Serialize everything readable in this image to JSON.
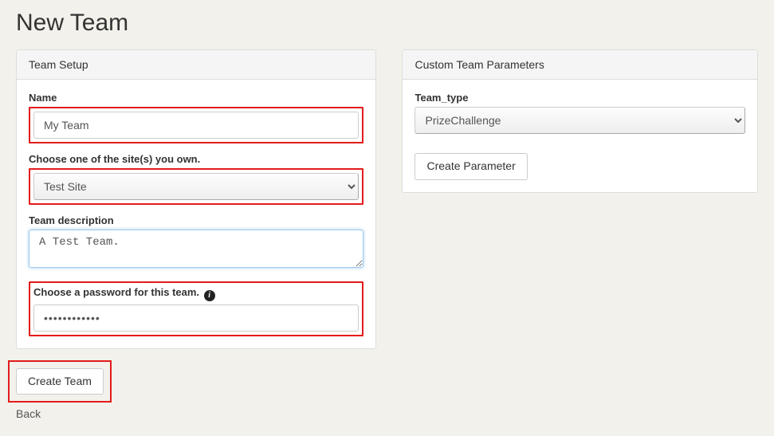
{
  "pageTitle": "New Team",
  "panels": {
    "setup": {
      "heading": "Team Setup",
      "name": {
        "label": "Name",
        "value": "My Team"
      },
      "site": {
        "label": "Choose one of the site(s) you own.",
        "value": "Test Site"
      },
      "desc": {
        "label": "Team description",
        "value": "A Test Team."
      },
      "password": {
        "label": "Choose a password for this team.",
        "value": "••••••••••••"
      }
    },
    "params": {
      "heading": "Custom Team Parameters",
      "type": {
        "label": "Team_type",
        "value": "PrizeChallenge"
      },
      "createBtn": "Create Parameter"
    }
  },
  "actions": {
    "createTeam": "Create Team",
    "back": "Back"
  }
}
